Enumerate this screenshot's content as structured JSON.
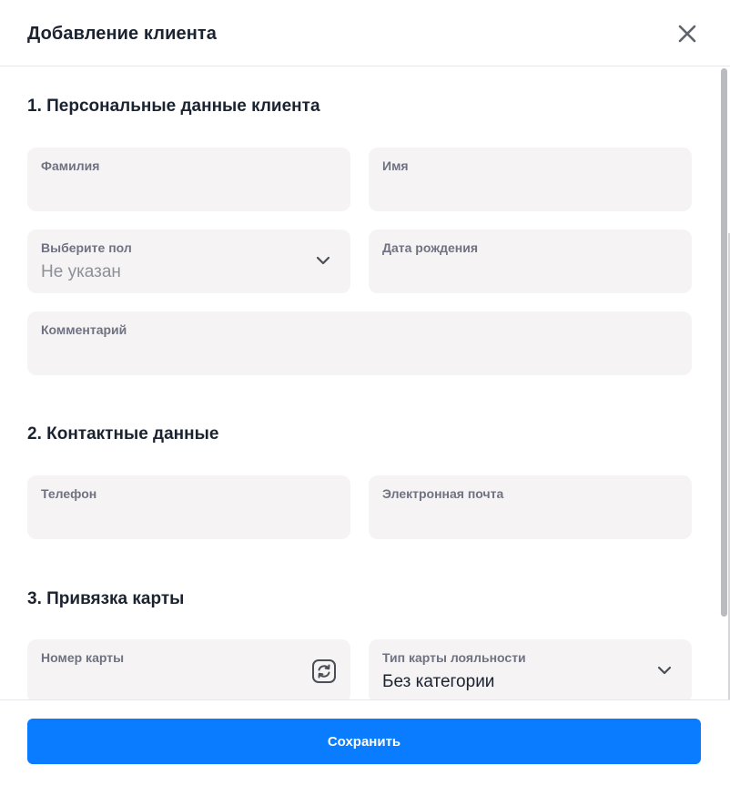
{
  "modal": {
    "title": "Добавление клиента"
  },
  "sections": [
    {
      "title": "1. Персональные данные клиента",
      "fields": [
        {
          "label": "Фамилия",
          "value": ""
        },
        {
          "label": "Имя",
          "value": ""
        },
        {
          "label": "Выберите пол",
          "value": "Не указан",
          "type": "select"
        },
        {
          "label": "Дата рождения",
          "value": ""
        },
        {
          "label": "Комментарий",
          "value": ""
        }
      ]
    },
    {
      "title": "2. Контактные данные",
      "fields": [
        {
          "label": "Телефон",
          "value": ""
        },
        {
          "label": "Электронная почта",
          "value": ""
        }
      ]
    },
    {
      "title": "3. Привязка карты",
      "fields": [
        {
          "label": "Номер карты",
          "value": "",
          "icon": "refresh-icon"
        },
        {
          "label": "Тип карты лояльности",
          "value": "Без категории",
          "type": "select"
        }
      ]
    }
  ],
  "footer": {
    "save_label": "Сохранить"
  },
  "colors": {
    "accent": "#0a7cff",
    "field_bg": "#f5f3f4",
    "label": "#6f7280",
    "text": "#1b2330"
  },
  "icons": {
    "close": "close-icon",
    "chevron": "chevron-down-icon",
    "refresh": "refresh-icon"
  }
}
